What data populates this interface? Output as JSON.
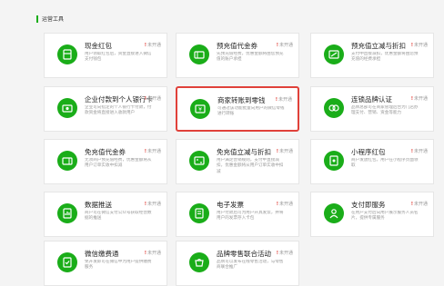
{
  "section": {
    "title": "运营工具"
  },
  "status_label": "未开通",
  "accent": "#1aad19",
  "highlight": "#e0413a",
  "cards": [
    {
      "title": "现金红包",
      "icon": "cash-red-packet-icon",
      "desc": "用户领取红包后，资金直接进入微信支付钱包"
    },
    {
      "title": "预充值代金券",
      "icon": "prepaid-voucher-icon",
      "desc": "先预充值经费，优惠金额将由您预充值的账户承担"
    },
    {
      "title": "预充值立减与折扣",
      "icon": "prepaid-discount-icon",
      "desc": "支付中直接减扣，优惠金额将由您预充值的经费承担"
    },
    {
      "title": "企业付款到个人银行卡",
      "icon": "pay-to-bank-icon",
      "desc": "企业可向指定的个人银行卡付款，付款资金将直接进入收款用户"
    },
    {
      "title": "商家转账到零钱",
      "icon": "merchant-transfer-icon",
      "desc": "可通过该功能批量向用户的微信零钱进行转账"
    },
    {
      "title": "连锁品牌认证",
      "icon": "chain-brand-icon",
      "desc": "品牌总部可在商家管理后台为门店办理支付、营销、资金等能力"
    },
    {
      "title": "免充值代金券",
      "icon": "free-voucher-icon",
      "desc": "无须商户预充值经费，优惠金额将从用户订单实收中扣减"
    },
    {
      "title": "免充值立减与折扣",
      "icon": "free-discount-icon",
      "desc": "用户满足营销规则，支付中直接减扣，优惠金额将从用户订单实收中扣减"
    },
    {
      "title": "小程序红包",
      "icon": "mini-program-packet-icon",
      "desc": "商户发放红包，用户在小程序页面领取"
    },
    {
      "title": "数据推送",
      "icon": "data-push-icon",
      "desc": "商户可在微信支付公众号获取经营数据的推送"
    },
    {
      "title": "电子发票",
      "icon": "e-invoice-icon",
      "desc": "用户付款后可为用户开具发票，并将用户的发票存入卡包"
    },
    {
      "title": "支付即服务",
      "icon": "pay-as-service-icon",
      "desc": "在用户支付后向用户展示服务人员名片，提供专属服务"
    },
    {
      "title": "微信缴费通",
      "icon": "wechat-billpay-icon",
      "desc": "免开发即可在微信中为用户提供缴费服务"
    },
    {
      "title": "品牌零售联合活动",
      "icon": "brand-retail-icon",
      "desc": "品牌可以发布在线零售活动，与零售商联合推广"
    },
    {
      "title": "",
      "icon": "",
      "desc": ""
    }
  ]
}
